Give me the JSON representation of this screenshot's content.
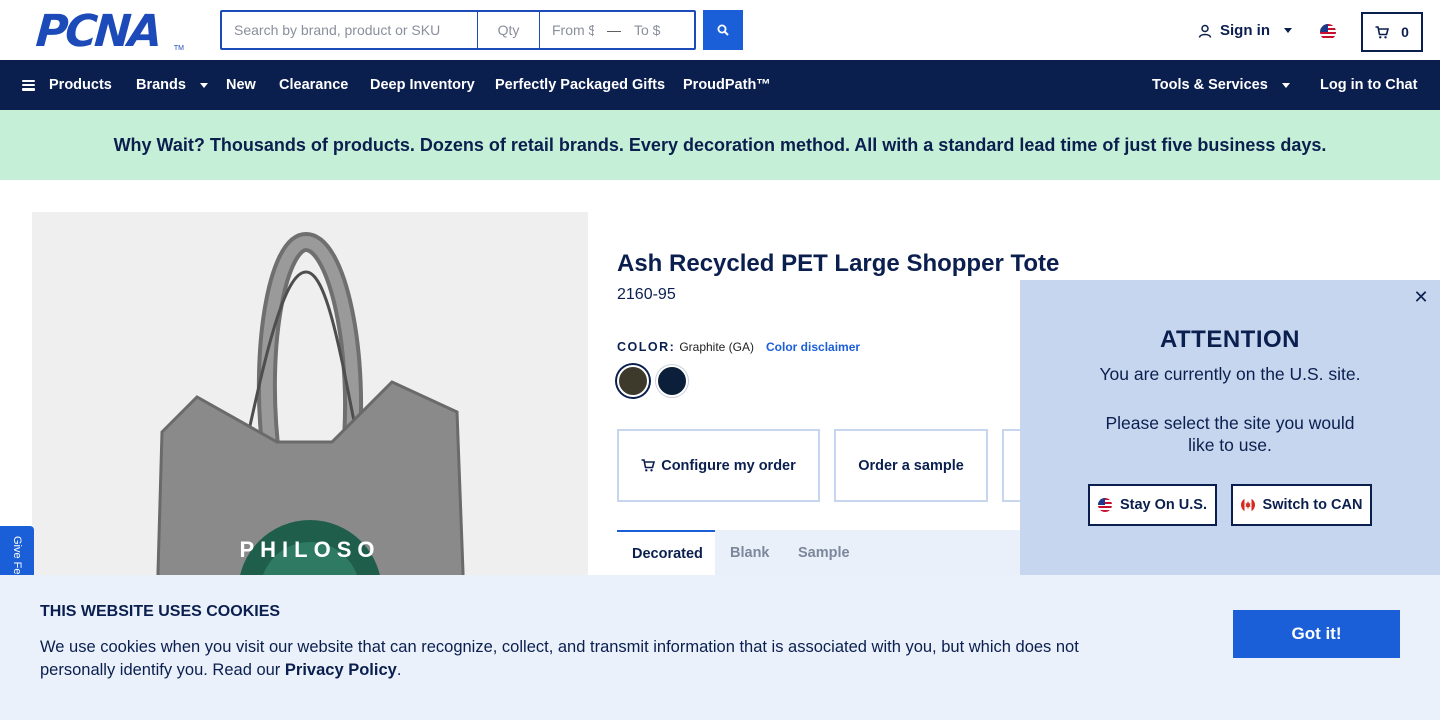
{
  "logo": {
    "text": "PCNA",
    "tm": "TM"
  },
  "search": {
    "placeholder": "Search by brand, product or SKU",
    "qty_placeholder": "Qty",
    "price_from_placeholder": "From $",
    "price_to_placeholder": "To $"
  },
  "account": {
    "signin_label": "Sign in",
    "cart_count": "0"
  },
  "nav": {
    "products": "Products",
    "brands": "Brands",
    "new": "New",
    "clearance": "Clearance",
    "deep_inventory": "Deep Inventory",
    "gifts": "Perfectly Packaged Gifts",
    "proudpath": "ProudPath™",
    "tools": "Tools & Services",
    "chat": "Log in to Chat"
  },
  "promo": {
    "text": "Why Wait? Thousands of products. Dozens of retail brands. Every decoration method. All with a standard lead time of just five business days."
  },
  "product": {
    "title": "Ash Recycled PET Large Shopper Tote",
    "sku": "2160-95",
    "color_label": "COLOR:",
    "color_value": "Graphite (GA)",
    "color_disclaimer": "Color disclaimer",
    "swatches": [
      {
        "name": "Graphite",
        "color": "#3d3a2c",
        "selected": true
      },
      {
        "name": "Navy",
        "color": "#0b1f3a",
        "selected": false
      }
    ],
    "image_text": "PHILOSO",
    "buttons": {
      "configure": "Configure my order",
      "sample": "Order a sample"
    },
    "tabs": [
      "Decorated",
      "Blank",
      "Sample"
    ]
  },
  "feedback": {
    "label": "Give Feedback"
  },
  "region_popup": {
    "title": "ATTENTION",
    "line1": "You are currently on the U.S. site.",
    "line2": "Please select the site you would like to use.",
    "stay_label": "Stay On U.S.",
    "switch_label": "Switch to CAN"
  },
  "cookie": {
    "title": "THIS WEBSITE USES COOKIES",
    "text": "We use cookies when you visit our website that can recognize, collect, and transmit information that is associated with you, but which does not personally identify you. Read our",
    "link": "Privacy Policy",
    "period": ".",
    "button": "Got it!"
  },
  "colors": {
    "navy": "#0b1f4f",
    "brand_blue": "#1a5fd8",
    "promo_bg": "#c5efd6",
    "popup_bg": "#c5d6ee"
  }
}
